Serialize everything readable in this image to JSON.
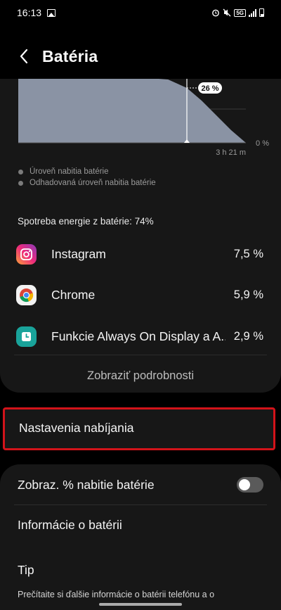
{
  "status_bar": {
    "time": "16:13",
    "network": "5G"
  },
  "header": {
    "title": "Batéria"
  },
  "chart_data": {
    "type": "area",
    "yticks": [
      "0 %"
    ],
    "xticks": [
      "3 h 21 m"
    ],
    "callout": "26 %",
    "series": [
      {
        "name": "Úroveň nabitia batérie",
        "values": [
          100,
          98,
          96,
          94,
          91,
          88,
          84,
          80,
          75,
          70,
          64,
          58,
          52,
          46,
          38,
          33,
          30,
          28,
          26
        ]
      },
      {
        "name": "Odhadovaná úroveň nabitia batérie",
        "values": [
          26,
          20,
          13,
          6,
          0
        ]
      }
    ],
    "legend": [
      "Úroveň nabitia batérie",
      "Odhadovaná úroveň nabitia batérie"
    ],
    "colors": {
      "area": "#8a93a4",
      "grid": "#3a3a3a",
      "marker": "#ffffff"
    }
  },
  "usage": {
    "label": "Spotreba energie z batérie: 74%",
    "apps": [
      {
        "name": "Instagram",
        "percent": "7,5 %",
        "icon": "instagram-icon"
      },
      {
        "name": "Chrome",
        "percent": "5,9 %",
        "icon": "chrome-icon"
      },
      {
        "name": "Funkcie Always On Display a A...",
        "percent": "2,9 %",
        "icon": "always-on-display-icon"
      }
    ],
    "details_label": "Zobraziť podrobnosti"
  },
  "charging": {
    "label": "Nastavenia nabíjania"
  },
  "settings": {
    "show_percent_label": "Zobraz. % nabitie batérie",
    "show_percent_on": false,
    "battery_info_label": "Informácie o batérii"
  },
  "tip": {
    "title": "Tip",
    "text": "Prečítaite si ďalšie informácie o batérii telefónu a o"
  }
}
